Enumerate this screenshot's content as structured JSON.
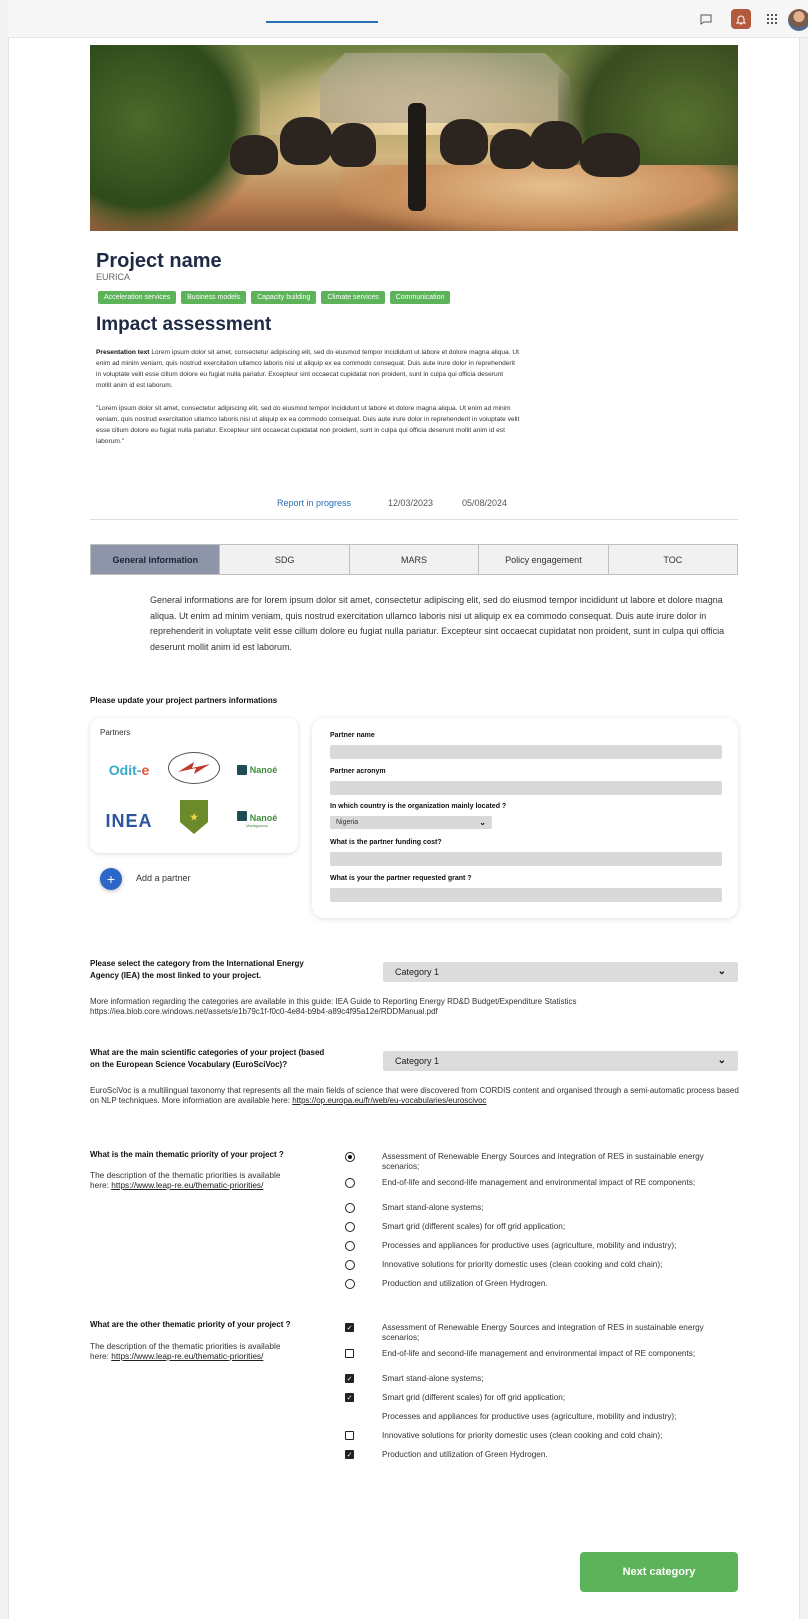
{
  "topbar": {
    "chat_icon": "chat-icon",
    "bell_icon": "bell-icon",
    "apps_icon": "apps-grid-icon",
    "accent": "#b35a3e"
  },
  "project": {
    "title": "Project name",
    "subtitle": "EURICA",
    "tags": [
      "Acceleration services",
      "Business models",
      "Capacity building",
      "Climate services",
      "Communication"
    ]
  },
  "impact": {
    "title": "Impact assessment",
    "presentation_bold": "Presentation text",
    "presentation_1": " Lorem ipsum dolor sit amet, consectetur adipiscing elit, sed do eiusmod tempor incididunt ut labore et dolore magna aliqua. Ut enim ad minim veniam, quis nostrud exercitation ullamco laboris nisi ut aliquip ex ea commodo consequat. Duis aute irure dolor in reprehenderit in voluptate velit esse cillum dolore eu fugiat nulla pariatur. Excepteur sint occaecat cupidatat non proident, sunt in culpa qui officia deserunt mollit anim id est laborum.",
    "presentation_2": "\"Lorem ipsum dolor sit amet, consectetur adipiscing elit, sed do eiusmod tempor incididunt ut labore et dolore magna aliqua. Ut enim ad minim veniam, quis nostrud exercitation ullamco laboris nisi ut aliquip ex ea commodo consequat. Duis aute irure dolor in reprehenderit in voluptate velit esse cillum dolore eu fugiat nulla pariatur. Excepteur sint occaecat cupidatat non proident, sunt in culpa qui officia deserunt mollit anim id est laborum.\""
  },
  "report_tabs": [
    "Report in progress",
    "12/03/2023",
    "05/08/2024"
  ],
  "category_tabs": [
    "General information",
    "SDG",
    "MARS",
    "Policy engagement",
    "TOC"
  ],
  "general_text": "General informations are for lorem ipsum dolor sit amet, consectetur adipiscing elit, sed do eiusmod tempor incididunt ut labore et dolore magna aliqua. Ut enim ad minim veniam, quis nostrud exercitation ullamco laboris nisi ut aliquip ex ea commodo consequat. Duis aute irure dolor in reprehenderit in voluptate velit esse cillum dolore eu fugiat nulla pariatur. Excepteur sint occaecat cupidatat non proident, sunt in culpa qui officia deserunt mollit anim id est laborum.",
  "partners": {
    "section_title": "Please update your project partners informations",
    "card_label": "Partners",
    "logos": {
      "odit_a": "Odit",
      "odit_b": "e",
      "inea": "INEA",
      "nanoe": "Nanoé",
      "nanoe_sub": "Madagascar"
    },
    "add_label": "Add a partner",
    "form": {
      "name_label": "Partner name",
      "acronym_label": "Partner acronym",
      "country_label": "In which country is the organization mainly located ?",
      "country_value": "Nigeria",
      "funding_label": "What is the partner funding cost?",
      "grant_label": "What is your the partner requested grant ?"
    }
  },
  "iea": {
    "question": "Please select the category from the International Energy Agency (IEA) the most linked to your project.",
    "selected": "Category 1",
    "info": "More information regarding the categories are available in this guide: IEA Guide to Reporting Energy RD&D Budget/Expenditure Statistics https://iea.blob.core.windows.net/assets/e1b79c1f-f0c0-4e84-b9b4-a89c4f95a12e/RDDManual.pdf"
  },
  "euroscivoc": {
    "question": "What are the main scientific categories of your project (based on the European Science Vocabulary (EuroSciVoc)?",
    "selected": "Category 1",
    "info": "EuroSciVoc is a multilingual taxonomy that represents all the main fields of science that were discovered from CORDIS content and organised through a semi-automatic process based on NLP techniques. More information are available here: ",
    "link": "https://op.europa.eu/fr/web/eu-vocabularies/euroscivoc"
  },
  "thematic_main": {
    "question": "What is the main thematic priority of your project ?",
    "desc": "The description of the thematic priorities is available here: ",
    "link": "https://www.leap-re.eu/thematic-priorities/",
    "options": [
      "Assessment of Renewable Energy Sources and integration of RES in sustainable energy scenarios;",
      "End-of-life and second-life management and environmental impact of RE components;",
      "Smart stand-alone systems;",
      "Smart grid (different scales) for off grid application;",
      "Processes and appliances for productive uses (agriculture, mobility and industry);",
      "Innovative solutions for priority domestic uses (clean cooking and cold chain);",
      "Production and utilization of Green Hydrogen."
    ],
    "selected_index": 0
  },
  "thematic_other": {
    "question": "What are the other thematic priority of your project ?",
    "desc": "The description of the thematic priorities is available here: ",
    "link": "https://www.leap-re.eu/thematic-priorities/",
    "options": [
      "Assessment of Renewable Energy Sources and integration of RES in sustainable energy scenarios;",
      "End-of-life and second-life management and environmental impact of RE components;",
      "Smart stand-alone systems;",
      "Smart grid (different scales) for off grid application;",
      "Processes and appliances for productive uses (agriculture, mobility and industry);",
      "Innovative solutions for priority domestic uses (clean cooking and cold chain);",
      "Production and utilization of Green Hydrogen."
    ],
    "checked": [
      true,
      false,
      true,
      true,
      null,
      false,
      true
    ]
  },
  "next_label": "Next category",
  "colors": {
    "green": "#5db35a",
    "blue": "#2b66c8",
    "active_tab": "#8e95a9"
  }
}
